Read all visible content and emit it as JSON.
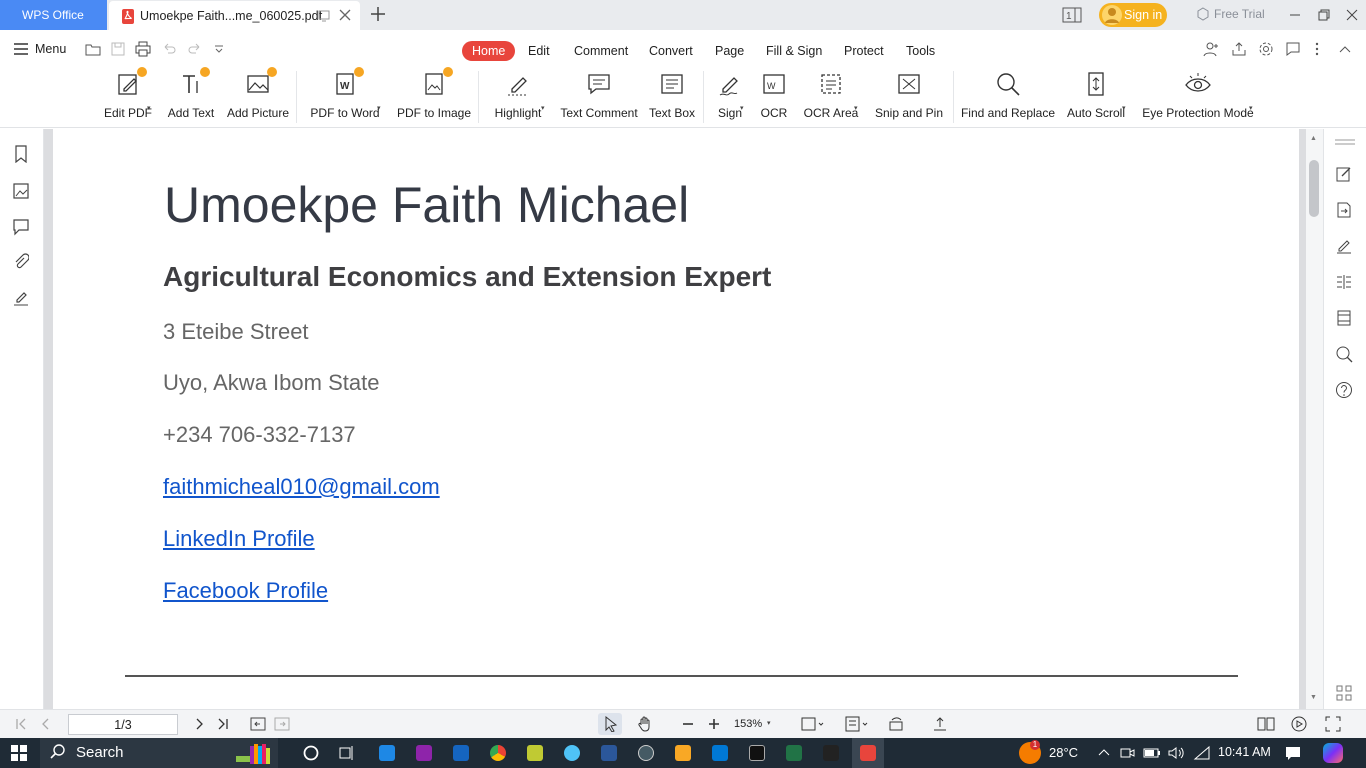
{
  "tabbar": {
    "app_tab": "WPS Office",
    "doc_tab_title": "Umoekpe Faith...me_060025.pdf",
    "sign_in": "Sign in",
    "free_trial": "Free Trial"
  },
  "menubar": {
    "menu_label": "Menu",
    "tabs": [
      "Home",
      "Edit",
      "Comment",
      "Convert",
      "Page",
      "Fill & Sign",
      "Protect",
      "Tools"
    ],
    "active_tab": "Home"
  },
  "ribbon": {
    "tools": [
      {
        "label": "Edit PDF",
        "icon": "edit-pdf-icon",
        "dropdown": true,
        "premium": true
      },
      {
        "label": "Add Text",
        "icon": "add-text-icon",
        "dropdown": false,
        "premium": true
      },
      {
        "label": "Add Picture",
        "icon": "add-picture-icon",
        "dropdown": false,
        "premium": true
      },
      {
        "label": "PDF to Word",
        "icon": "pdf-to-word-icon",
        "dropdown": true,
        "premium": true
      },
      {
        "label": "PDF to Image",
        "icon": "pdf-to-image-icon",
        "dropdown": false,
        "premium": true
      },
      {
        "label": "Highlight",
        "icon": "highlight-icon",
        "dropdown": true,
        "premium": false
      },
      {
        "label": "Text Comment",
        "icon": "text-comment-icon",
        "dropdown": false,
        "premium": false
      },
      {
        "label": "Text Box",
        "icon": "text-box-icon",
        "dropdown": false,
        "premium": false
      },
      {
        "label": "Sign",
        "icon": "sign-icon",
        "dropdown": true,
        "premium": false
      },
      {
        "label": "OCR",
        "icon": "ocr-icon",
        "dropdown": false,
        "premium": false
      },
      {
        "label": "OCR Area",
        "icon": "ocr-area-icon",
        "dropdown": true,
        "premium": false
      },
      {
        "label": "Snip and Pin",
        "icon": "snip-and-pin-icon",
        "dropdown": false,
        "premium": false
      },
      {
        "label": "Find and Replace",
        "icon": "find-and-replace-icon",
        "dropdown": false,
        "premium": false
      },
      {
        "label": "Auto Scroll",
        "icon": "auto-scroll-icon",
        "dropdown": true,
        "premium": false
      },
      {
        "label": "Eye Protection Mode",
        "icon": "eye-protection-icon",
        "dropdown": true,
        "premium": false
      }
    ]
  },
  "document": {
    "name": "Umoekpe Faith Michael",
    "subtitle": "Agricultural Economics and Extension Expert",
    "address_line1": "3 Eteibe Street",
    "address_line2": "Uyo, Akwa Ibom State",
    "phone": "+234 706-332-7137",
    "email": "faithmicheal010@gmail.com",
    "linkedin": "LinkedIn Profile",
    "facebook": "Facebook Profile"
  },
  "statusbar": {
    "page": "1/3",
    "zoom": "153%"
  },
  "taskbar": {
    "search": "Search",
    "weather_badge": "1",
    "temperature": "28°C",
    "time": "10:41 AM"
  },
  "colors": {
    "accent": "#e8453c",
    "wps_blue": "#4a8af4",
    "sign_in": "#f5b21f",
    "link": "#1155cc"
  }
}
